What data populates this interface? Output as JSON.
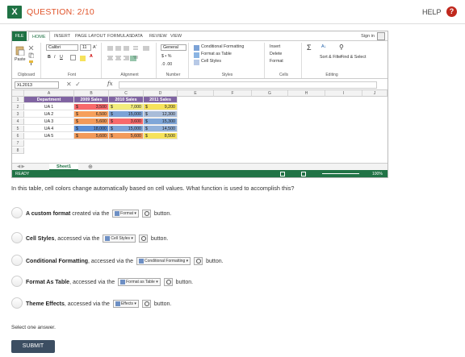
{
  "header": {
    "app_icon": "excel-icon",
    "question": "QUESTION: 2/10",
    "help": "HELP",
    "help_badge": "?",
    "colors": {
      "question": "#e0532a",
      "help_badge": "#c0281d"
    }
  },
  "excel": {
    "tabs": [
      "FILE",
      "HOME",
      "INSERT",
      "PAGE LAYOUT",
      "FORMULAS",
      "DATA",
      "REVIEW",
      "VIEW"
    ],
    "active_tab": "HOME",
    "sign_in": "Sign in",
    "ribbon": {
      "paste": "Paste",
      "font_name": "Calibri",
      "font_size": "11",
      "number_format": "General",
      "cond_format": "Conditional Formatting",
      "format_table": "Format as Table",
      "cell_styles": "Cell Styles",
      "insert": "Insert",
      "delete": "Delete",
      "format": "Format",
      "sort_filter": "Sort & Filter",
      "find_select": "Find & Select",
      "groups": [
        "Clipboard",
        "Font",
        "Alignment",
        "Number",
        "Styles",
        "Cells",
        "Editing"
      ]
    },
    "name_box": "XL2013",
    "fx": "fx",
    "columns": [
      "A",
      "B",
      "C",
      "D",
      "E",
      "F",
      "G",
      "H",
      "I",
      "J"
    ],
    "rows": [
      "1",
      "2",
      "3",
      "4",
      "5",
      "6",
      "7",
      "8"
    ],
    "table_headers": [
      "Department",
      "2009 Sales",
      "2010 Sales",
      "2011 Sales"
    ],
    "table_rows": [
      {
        "dept": "UA 1",
        "s2009": "3,500",
        "s2010": "7,000",
        "s2011": "9,200",
        "c2009": "#f8696b",
        "c2010": "#f2ec7c",
        "c2011": "#f6e25b"
      },
      {
        "dept": "UA 2",
        "s2009": "6,500",
        "s2010": "15,000",
        "s2011": "12,300",
        "c2009": "#f6a05c",
        "c2010": "#7ca2d6",
        "c2011": "#a8bcd9"
      },
      {
        "dept": "UA 3",
        "s2009": "5,600",
        "s2010": "3,600",
        "s2011": "15,300",
        "c2009": "#f29a5a",
        "c2010": "#f8696b",
        "c2011": "#7fa6d8"
      },
      {
        "dept": "UA 4",
        "s2009": "18,000",
        "s2010": "15,000",
        "s2011": "14,500",
        "c2009": "#5b8fd6",
        "c2010": "#7ca2d6",
        "c2011": "#92b1da"
      },
      {
        "dept": "UA 5",
        "s2009": "5,600",
        "s2010": "5,600",
        "s2011": "8,500",
        "c2009": "#f29a5a",
        "c2010": "#f29a5a",
        "c2011": "#f6e25b"
      }
    ],
    "currency": "$",
    "sheet_tab": "Sheet1",
    "status": "READY",
    "zoom": "100%"
  },
  "question_text": "In this table, cell colors change automatically based on cell values. What function is used to accomplish this?",
  "options": [
    {
      "bold": "A custom format",
      "pre": " created via the ",
      "btn": "Format",
      "post": " button."
    },
    {
      "bold": "Cell Styles",
      "pre": ", accessed via the ",
      "btn": "Cell Styles",
      "post": " button."
    },
    {
      "bold": "Conditional Formatting",
      "pre": ", accessed via the ",
      "btn": "Conditional Formatting",
      "post": " button."
    },
    {
      "bold": "Format As Table",
      "pre": ", accessed via the ",
      "btn": "Format as Table",
      "post": " button."
    },
    {
      "bold": "Theme Effects",
      "pre": ", accessed via the ",
      "btn": "Effects",
      "post": " button."
    }
  ],
  "select_one": "Select one answer.",
  "submit": "SUBMIT",
  "colors": {
    "excel_green": "#217346",
    "header_purple": "#8064a2",
    "submit": "#3c4e62"
  }
}
